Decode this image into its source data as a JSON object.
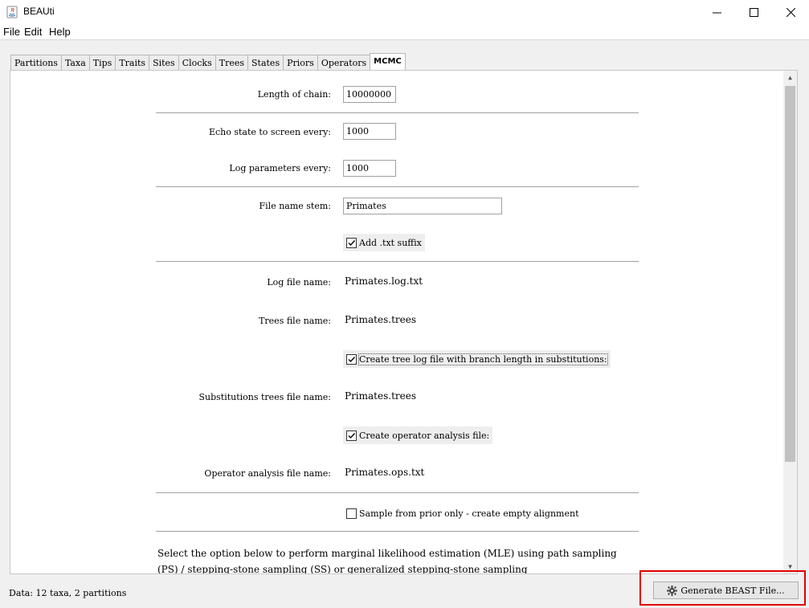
{
  "window": {
    "title": "BEAUti"
  },
  "menu": [
    "File",
    "Edit",
    "Help"
  ],
  "tabs": [
    "Partitions",
    "Taxa",
    "Tips",
    "Traits",
    "Sites",
    "Clocks",
    "Trees",
    "States",
    "Priors",
    "Operators",
    "MCMC"
  ],
  "active_tab": "MCMC",
  "mcmc": {
    "chain_length_label": "Length of chain:",
    "chain_length_value": "10000000",
    "echo_label": "Echo state to screen every:",
    "echo_value": "1000",
    "log_params_label": "Log parameters every:",
    "log_params_value": "1000",
    "file_stem_label": "File name stem:",
    "file_stem_value": "Primates",
    "txt_suffix_label": "Add .txt suffix",
    "log_file_label": "Log file name:",
    "log_file_value": "Primates.log.txt",
    "trees_file_label": "Trees file name:",
    "trees_file_value": "Primates.trees",
    "tree_log_subst_label": "Create tree log file with branch length in substitutions:",
    "subst_trees_label": "Substitutions trees file name:",
    "subst_trees_value": "Primates.trees",
    "op_analysis_check_label": "Create operator analysis file:",
    "op_analysis_label": "Operator analysis file name:",
    "op_analysis_value": "Primates.ops.txt",
    "sample_prior_label": "Sample from prior only - create empty alignment",
    "mle_text": "Select the option below to perform marginal likelihood estimation (MLE) using path sampling (PS) / stepping-stone sampling (SS) or generalized stepping-stone sampling"
  },
  "status": "Data: 12 taxa, 2 partitions",
  "generate_button": "Generate BEAST File..."
}
